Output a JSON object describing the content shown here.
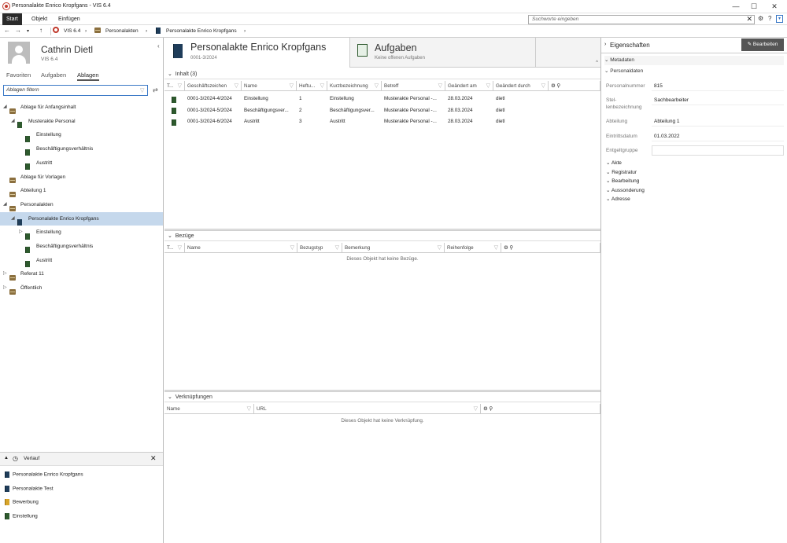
{
  "window": {
    "title": "Personalakte Enrico Kropfgans - VIS 6.4"
  },
  "menu": {
    "items": [
      "Start",
      "Objekt",
      "Einfügen"
    ]
  },
  "search": {
    "placeholder": "Suchworte eingeben"
  },
  "breadcrumb": {
    "items": [
      "VIS 6.4",
      "Personalakten",
      "Personalakte Enrico Kropfgans"
    ]
  },
  "user": {
    "name": "Cathrin Dietl",
    "version": "VIS 6.4"
  },
  "left_tabs": [
    "Favoriten",
    "Aufgaben",
    "Ablagen"
  ],
  "filter": {
    "value": "Ablagen filtern"
  },
  "tree": [
    {
      "label": "Ablage für Anfangsinhalt",
      "level": 0,
      "icon": "cabinet-icon",
      "toggle": "expanded"
    },
    {
      "label": "Musterakte Personal",
      "level": 1,
      "icon": "book-icon",
      "toggle": "expanded"
    },
    {
      "label": "Einstellung",
      "level": 2,
      "icon": "book-icon",
      "toggle": ""
    },
    {
      "label": "Beschäftigungsverhältnis",
      "level": 2,
      "icon": "book-icon",
      "toggle": ""
    },
    {
      "label": "Austritt",
      "level": 2,
      "icon": "book-icon",
      "toggle": ""
    },
    {
      "label": "Ablage für Vorlagen",
      "level": 0,
      "icon": "cabinet-icon",
      "toggle": ""
    },
    {
      "label": "Abteilung 1",
      "level": 0,
      "icon": "cabinet-icon",
      "toggle": ""
    },
    {
      "label": "Personalakten",
      "level": 0,
      "icon": "cabinet-icon",
      "toggle": "expanded"
    },
    {
      "label": "Personalakte Enrico Kropfgans",
      "level": 1,
      "icon": "book-icon",
      "toggle": "expanded",
      "selected": true
    },
    {
      "label": "Einstellung",
      "level": 2,
      "icon": "book-icon",
      "toggle": "collapsed"
    },
    {
      "label": "Beschäftigungsverhältnis",
      "level": 2,
      "icon": "book-icon",
      "toggle": ""
    },
    {
      "label": "Austritt",
      "level": 2,
      "icon": "book-icon",
      "toggle": ""
    },
    {
      "label": "Referat 11",
      "level": 0,
      "icon": "cabinet-icon",
      "toggle": "collapsed"
    },
    {
      "label": "Öffentlich",
      "level": 0,
      "icon": "cabinet-icon",
      "toggle": "collapsed"
    }
  ],
  "history": {
    "title": "Verlauf",
    "items": [
      {
        "label": "Personalakte Enrico Kropfgans",
        "icon": "book-icon"
      },
      {
        "label": "Personalakte Test",
        "icon": "book-icon"
      },
      {
        "label": "Bewerbung",
        "icon": "folder-icon"
      },
      {
        "label": "Einstellung",
        "icon": "book-icon"
      }
    ]
  },
  "doc": {
    "title": "Personalakte Enrico Kropfgans",
    "subtitle": "0001-3/2024"
  },
  "tasks": {
    "title": "Aufgaben",
    "subtitle": "Keine offenen Aufgaben"
  },
  "inhalt": {
    "header": "Inhalt (3)",
    "columns": [
      "T...",
      "Geschäftszeichen",
      "Name",
      "Heftu...",
      "Kurzbezeichnung",
      "Betreff",
      "Geändert am",
      "Geändert durch"
    ],
    "rows": [
      [
        "",
        "0001-3/2024-4/2024",
        "Einstellung",
        "1",
        "Einstellung",
        "Musterakte Personal -...",
        "28.03.2024",
        "dietl"
      ],
      [
        "",
        "0001-3/2024-5/2024",
        "Beschäftigungsver...",
        "2",
        "Beschäftigungsver...",
        "Musterakte Personal -...",
        "28.03.2024",
        "dietl"
      ],
      [
        "",
        "0001-3/2024-6/2024",
        "Austritt",
        "3",
        "Austritt",
        "Musterakte Personal -...",
        "28.03.2024",
        "dietl"
      ]
    ]
  },
  "bezuege": {
    "header": "Bezüge",
    "columns": [
      "T...",
      "Name",
      "Bezugstyp",
      "Bemerkung",
      "Reihenfolge"
    ],
    "empty": "Dieses Objekt hat keine Bezüge."
  },
  "verknuepfungen": {
    "header": "Verknüpfungen",
    "columns": [
      "Name",
      "URL"
    ],
    "empty": "Dieses Objekt hat keine Verknüpfung."
  },
  "properties": {
    "title": "Eigenschaften",
    "edit_label": "Bearbeiten",
    "metadata_label": "Metadaten",
    "personal_label": "Personaldaten",
    "fields": [
      {
        "label": "Personalnummer",
        "value": "815"
      },
      {
        "label": "Stel-lenbezeichnung",
        "value": "Sachbearbeiter"
      },
      {
        "label": "Abteilung",
        "value": "Abteilung 1"
      },
      {
        "label": "Eintrittsdatum",
        "value": "01.03.2022"
      },
      {
        "label": "Entgeltgruppe",
        "value": ""
      }
    ],
    "groups": [
      "Akte",
      "Registratur",
      "Bearbeitung",
      "Aussonderung",
      "Adresse"
    ]
  },
  "colors": {
    "accent": "#3a78c6",
    "selection": "#c5d8ec",
    "menu_active": "#2b2b2b",
    "edit_button": "#555555"
  }
}
